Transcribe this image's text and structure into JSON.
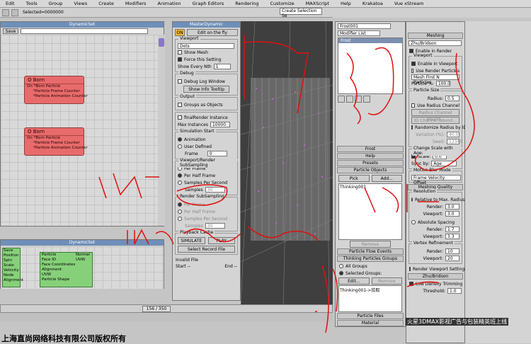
{
  "menu": [
    "Edit",
    "Tools",
    "Group",
    "Views",
    "Create",
    "Modifiers",
    "Animation",
    "Graph Editors",
    "Rendering",
    "Customize",
    "MAXScript",
    "Help",
    "Krakatoa",
    "Vue xStream"
  ],
  "toolbar": {
    "selection_set_placeholder": "Create Selection Se"
  },
  "dynamicset": {
    "title": "DynamicSet",
    "save": "Save",
    "nodes": [
      {
        "name": "O Born",
        "lines": [
          "On   *Born Particle",
          "*Particle Frame Counter",
          "*Particle Animation Counter"
        ]
      },
      {
        "name": "O Born",
        "lines": [
          "On   *Born Particle",
          "*Particle Frame Counter",
          "*Particle Animation Counter"
        ]
      }
    ]
  },
  "dynamicset2": {
    "title": "DynamicSet",
    "save": "Save",
    "left_items": [
      "Position",
      "Spin",
      "Scale",
      "Velocity",
      "Node",
      "Alignment"
    ],
    "mid_items": [
      "Particle",
      "Face ID",
      "Face Coordinates",
      "Alignment",
      "UVW",
      "Particle Shape"
    ],
    "mid_right": [
      "Normal",
      "UVW"
    ]
  },
  "master": {
    "title": "MasterDynamic",
    "on": "ON",
    "edit_on_fly": "Edit on the fly",
    "viewport_label": "Viewport",
    "viewport_mode": "Dots",
    "show_mesh": "Show Mesh",
    "force_setting": "Force this Setting",
    "show_every": "Show Every Nth",
    "show_every_val": "1",
    "debug_label": "Debug",
    "debug_log": "Debug Log Window",
    "show_info": "Show Info Tooltip",
    "output_label": "Output",
    "groups_objects": "Groups as Objects",
    "final_render": "finalRender Instance",
    "max_instances": "Max Instances",
    "max_instances_val": "10000",
    "sim_start": "Simulation Start",
    "animation": "Animation",
    "user_defined": "User Defined",
    "frame": "Frame",
    "frame_val": "0",
    "vr_subsampling": "Viewport/Render SubSampling",
    "per_frame": "Per Frame",
    "per_half_frame": "Per Half Frame",
    "samples_per_second": "Samples Per Second",
    "samples": "Samples",
    "samples_val": "30",
    "render_subsampling": "Render SubSampling",
    "per_frame2": "Per Frame",
    "per_half_frame2": "Per Half Frame",
    "samples_per_second2": "Samples Per Second",
    "samples2": "Samples",
    "samples2_val": "30",
    "playback_cache": "Playback Cache",
    "simulate": "SIMULATE",
    "play": "PLAY",
    "select_record": "Select Record File",
    "invalid_file": "Invalid File",
    "start": "Start --",
    "end": "End --"
  },
  "modify": {
    "object_name": "Frost001",
    "modifier_list": "Modifier List",
    "stack_item": "Frost",
    "rollouts": [
      "Frost",
      "Help",
      "Presets"
    ],
    "particle_objects": "Particle Objects",
    "pick": "Pick",
    "add": "Add...",
    "list_item": "Thinking001",
    "remove": "Remove",
    "particle_flow_events": "Particle Flow Events",
    "tp_groups": "Thinking Particles Groups",
    "all_groups": "All Groups",
    "selected_groups": "Selected Groups:",
    "edit": "Edit...",
    "remove2": "Remove",
    "group_item": "Thinking001->拾取",
    "particle_files": "Particle Files",
    "material": "Material"
  },
  "meshing": {
    "title": "Meshing",
    "method": "Zhu/Bridson",
    "enable_render": "Enable in Render",
    "viewport_label": "Viewport",
    "enable_viewport": "Enable in Viewport",
    "use_render_particles": "Use Render Particles",
    "mesh_first": "Mesh First N Particles",
    "particle_pct": "Particle %:",
    "particle_pct_val": "100.0",
    "particle_size": "Particle Size",
    "radius": "Radius:",
    "radius_val": "0.5",
    "use_radius_channel": "Use Radius Channel",
    "radius_channel_bounds": "Radius Channel Bound...",
    "id_channel_bounds": "ID Channel Bound...",
    "randomize": "Randomize Radius by ID",
    "variation": "Variation (%):",
    "variation_val": "40.0",
    "seed": "Seed:",
    "seed_val": "12345",
    "change_scale": "Change Scale with Age:",
    "scale": "Scale:",
    "scale_val": "0.0",
    "sync_by": "Sync by:",
    "sync_val": "Age",
    "motion_blur": "Motion Blur Mode",
    "motion_blur_val": "Frame Velocity Offset",
    "meshing_quality": "Meshing Quality",
    "resolution": "Resolution",
    "relative": "Relative to Max. Radius",
    "render": "Render:",
    "render_val": "3.0",
    "viewport": "Viewport:",
    "viewport_val": "3.0",
    "absolute_spacing": "Absolute Spacing",
    "render2": "Render:",
    "render2_val": "1.7",
    "viewport2": "Viewport:",
    "viewport2_val": "3.3",
    "vertex_refinement": "Vertex Refinement",
    "vr_render": "Render:",
    "vr_render_val": "10",
    "vr_viewport": "Viewport:",
    "vr_viewport_val": "20",
    "render_viewport_settings": "Render Viewport Settings",
    "zhu_title": "Zhu/Bridson",
    "low_density": "Low Density Trimming",
    "threshold": "Threshold:",
    "threshold_val": "1.0"
  },
  "timeline": {
    "frame_text": "156 / 350"
  },
  "watermarks": {
    "bottom_left": "上海直尚网络科技有限公司版权所有",
    "bottom_right": "火星3DMAX影视广告与包装精英班上线"
  },
  "status": {
    "selected": "Selected=0000000"
  }
}
